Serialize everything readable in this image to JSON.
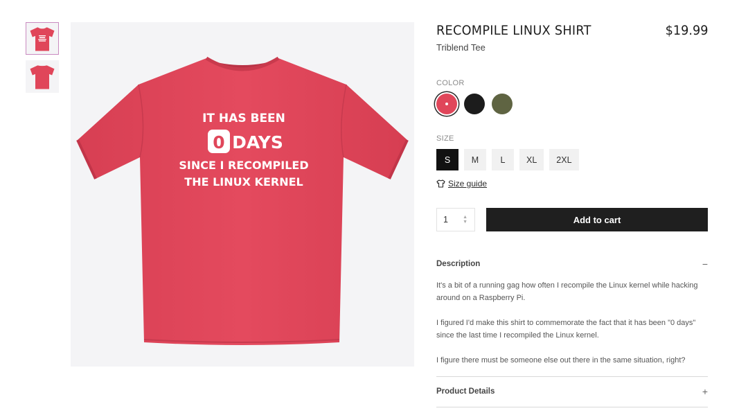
{
  "gallery": {
    "thumbnails": [
      "front-thumbnail",
      "back-thumbnail"
    ],
    "selected_index": 0,
    "shirt_color": "#e0465a"
  },
  "shirt_print": {
    "line1": "IT HAS BEEN",
    "digit": "0",
    "line2": "DAYS",
    "line3": "SINCE I RECOMPILED",
    "line4": "THE LINUX KERNEL"
  },
  "product": {
    "title": "RECOMPILE LINUX SHIRT",
    "price": "$19.99",
    "subtitle": "Triblend Tee"
  },
  "color_option": {
    "label": "COLOR",
    "swatches": [
      {
        "name": "red",
        "hex": "#e0465a",
        "selected": true
      },
      {
        "name": "black",
        "hex": "#1c1c1c",
        "selected": false
      },
      {
        "name": "olive",
        "hex": "#5f6442",
        "selected": false
      }
    ]
  },
  "size_option": {
    "label": "SIZE",
    "sizes": [
      "S",
      "M",
      "L",
      "XL",
      "2XL"
    ],
    "selected": "S"
  },
  "size_guide": {
    "label": "Size guide",
    "icon": "shirt-icon"
  },
  "cart": {
    "quantity": "1",
    "add_label": "Add to cart"
  },
  "description": {
    "heading": "Description",
    "toggle": "−",
    "paragraphs": [
      "It's a bit of a running gag how often I recompile the Linux kernel while hacking around on a Raspberry Pi.",
      "I figured I'd make this shirt to commemorate the fact that it has been \"0 days\" since the last time I recompiled the Linux kernel.",
      "I figure there must be someone else out there in the same situation, right?"
    ]
  },
  "product_details": {
    "heading": "Product Details",
    "toggle": "+"
  }
}
